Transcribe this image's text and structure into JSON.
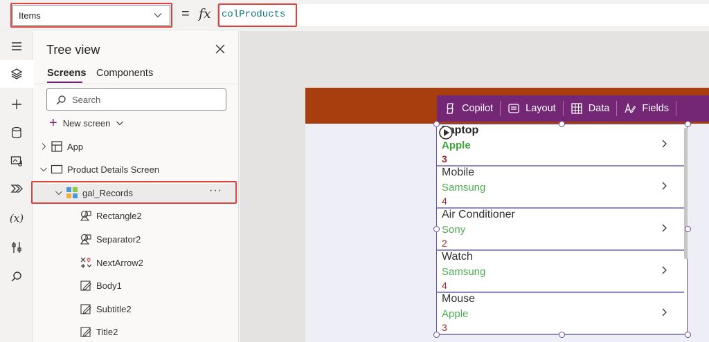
{
  "formula_bar": {
    "property": "Items",
    "equals": "=",
    "fx": "fx",
    "formula": "colProducts"
  },
  "left_rail": {
    "items": [
      "hamburger-icon",
      "tree-view-icon",
      "insert-icon",
      "data-icon",
      "media-icon",
      "power-automate-icon",
      "variables-icon",
      "advanced-tools-icon",
      "search-icon"
    ],
    "variables_glyph": "(x)"
  },
  "tree_view": {
    "title": "Tree view",
    "tabs": [
      {
        "label": "Screens"
      },
      {
        "label": "Components"
      }
    ],
    "search_placeholder": "Search",
    "new_screen": "New screen",
    "nodes": {
      "app": "App",
      "screen": "Product Details Screen",
      "gallery": "gal_Records",
      "children": [
        "Rectangle2",
        "Separator2",
        "NextArrow2",
        "Body1",
        "Subtitle2",
        "Title2"
      ]
    },
    "more": "···"
  },
  "canvas": {
    "command_bar": [
      {
        "label": "Copilot"
      },
      {
        "label": "Layout"
      },
      {
        "label": "Data"
      },
      {
        "label": "Fields"
      }
    ],
    "gallery_rows": [
      {
        "title": "Laptop",
        "subtitle": "Apple",
        "body": "3"
      },
      {
        "title": "Mobile",
        "subtitle": "Samsung",
        "body": "4"
      },
      {
        "title": "Air Conditioner",
        "subtitle": "Sony",
        "body": "2"
      },
      {
        "title": "Watch",
        "subtitle": "Samsung",
        "body": "4"
      },
      {
        "title": "Mouse",
        "subtitle": "Apple",
        "body": "3"
      }
    ]
  },
  "colors": {
    "accent": "#742774",
    "header": "#a83e0d",
    "highlight": "#e0413f",
    "subtitle": "#4caf50",
    "body": "#a4262c"
  }
}
